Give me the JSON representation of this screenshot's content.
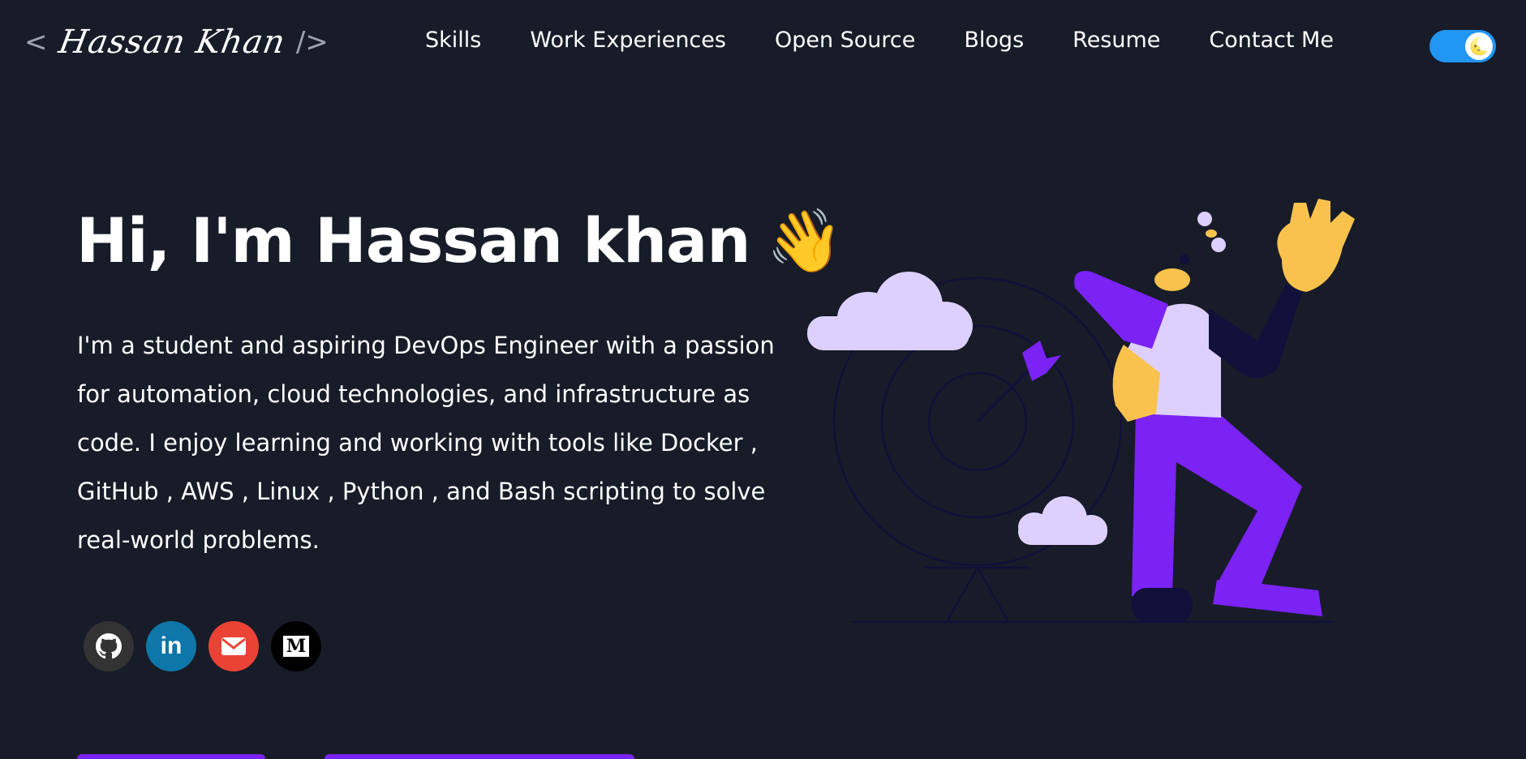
{
  "header": {
    "logo_open": "<",
    "logo_name": "Hassan Khan",
    "logo_close": "/>",
    "nav": [
      "Skills",
      "Work Experiences",
      "Open Source",
      "Blogs",
      "Resume",
      "Contact Me"
    ],
    "theme_toggle_icon": "moon-emoji"
  },
  "hero": {
    "greeting": "Hi, I'm Hassan khan",
    "wave": "👋",
    "intro": "I'm a student and aspiring DevOps Engineer with a passion for automation, cloud technologies, and infrastructure as code. I enjoy learning and working with tools like Docker , GitHub , AWS , Linux , Python , and Bash scripting to solve real-world problems."
  },
  "social": [
    {
      "name": "github",
      "icon": "github-icon",
      "color": "#333333"
    },
    {
      "name": "linkedin",
      "icon": "linkedin-icon",
      "color": "#0e76a8",
      "glyph": "in"
    },
    {
      "name": "email",
      "icon": "mail-icon",
      "color": "#ea4335"
    },
    {
      "name": "medium",
      "icon": "medium-icon",
      "color": "#000000",
      "glyph": "M"
    }
  ],
  "colors": {
    "background": "#171c28",
    "accent": "#7b22f5",
    "toggle": "#2196f3"
  }
}
